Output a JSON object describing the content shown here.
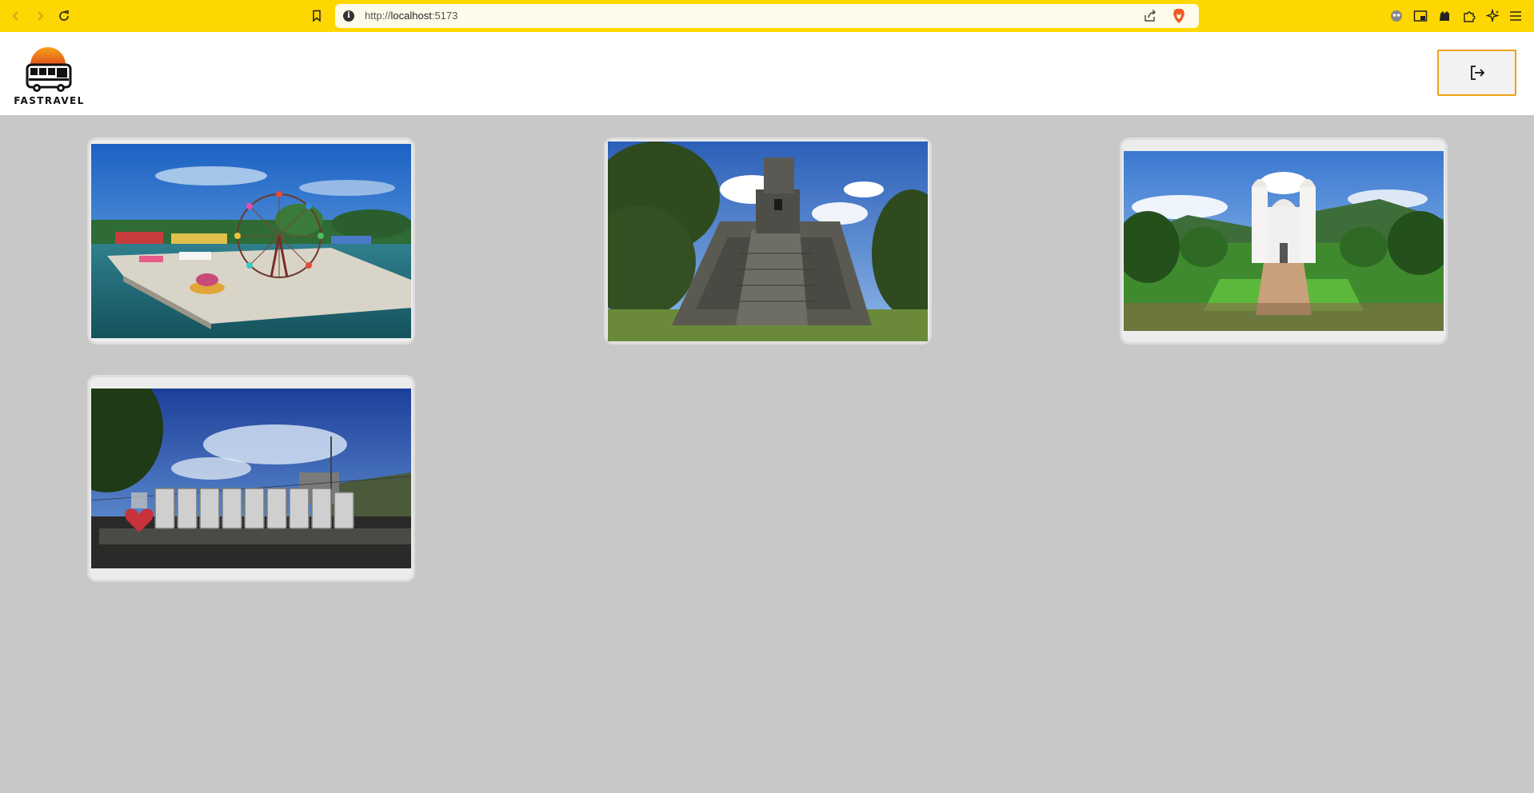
{
  "browser": {
    "url_scheme": "http://",
    "url_host": "localhost",
    "url_port": ":5173"
  },
  "header": {
    "logo_text": "FASTRAVEL",
    "logout_icon": "logout-icon"
  },
  "destinations": [
    {
      "name": "puerto-barrios-waterfront",
      "icon": "photo"
    },
    {
      "name": "tikal-temple",
      "icon": "photo"
    },
    {
      "name": "esquipulas-basilica",
      "icon": "photo"
    },
    {
      "name": "pachalum-sign",
      "icon": "photo"
    }
  ],
  "colors": {
    "browser_bar": "#ffd700",
    "background": "#c8c8c8",
    "accent": "#f0a21a"
  }
}
